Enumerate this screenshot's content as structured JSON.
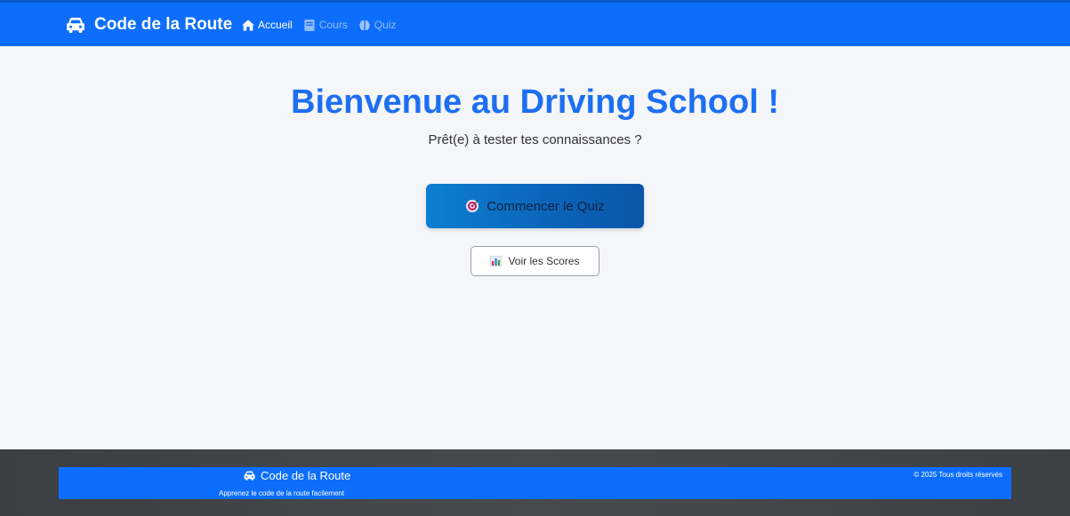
{
  "navbar": {
    "brand": "Code de la Route",
    "links": [
      {
        "label": "Accueil",
        "icon": "home-icon",
        "active": true
      },
      {
        "label": "Cours",
        "icon": "book-icon",
        "active": false
      },
      {
        "label": "Quiz",
        "icon": "brain-icon",
        "active": false
      }
    ]
  },
  "hero": {
    "title": "Bienvenue au Driving School !",
    "subtitle": "Prêt(e) à tester tes connaissances ?"
  },
  "actions": {
    "quiz_label": "Commencer le Quiz",
    "quiz_icon": "target-icon",
    "scores_label": "Voir les Scores",
    "scores_icon": "bar-chart-icon"
  },
  "footer": {
    "brand": "Code de la Route",
    "tagline": "Apprenez le code de la route facilement",
    "copyright": "© 2025 Tous droits réservés"
  },
  "colors": {
    "primary": "#0d6efd",
    "title": "#1d6ff2",
    "footer_bg": "#3a3f44",
    "page_bg": "#f4f6f9"
  }
}
